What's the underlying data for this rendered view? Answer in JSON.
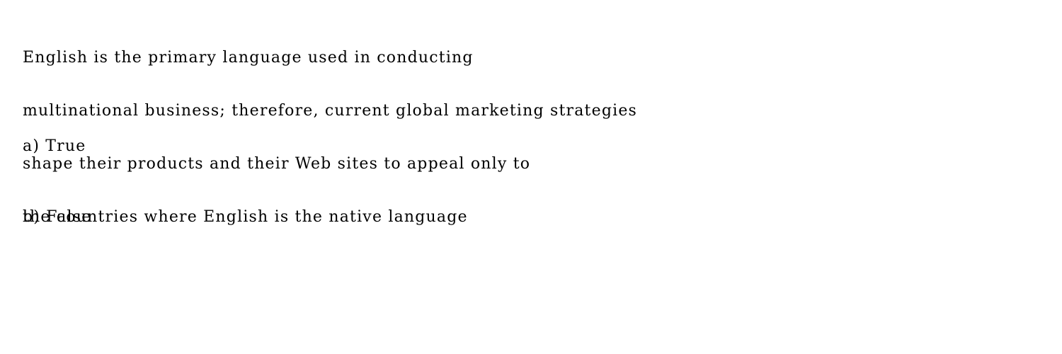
{
  "question": {
    "lines": [
      "English is the primary language used in conducting",
      "multinational business; therefore, current global marketing strategies",
      "shape their products and their Web sites to appeal only to",
      "the countries where English is the native language"
    ]
  },
  "options": [
    {
      "label": "a) True"
    },
    {
      "label": "b) False"
    }
  ]
}
